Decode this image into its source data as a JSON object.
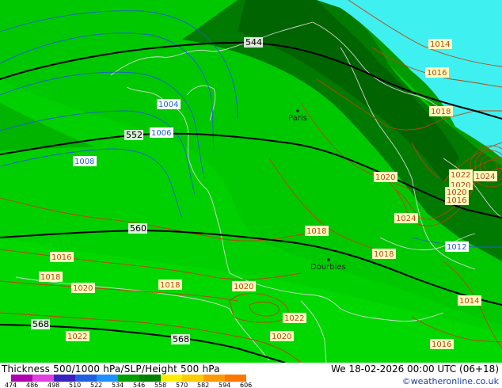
{
  "map": {
    "title": "Thickness 500/1000 hPa/SLP/Height 500 hPa",
    "datetime": "We 18-02-2026 00:00 UTC (06+18)",
    "credit": "©weatheronline.co.uk",
    "cities": [
      "Paris",
      "Dourbies"
    ],
    "thickness_labels": [
      "544",
      "552",
      "560",
      "568",
      "568"
    ],
    "pressure_labels": [
      "1014",
      "1016",
      "1018",
      "1004",
      "1006",
      "1008",
      "1020",
      "1022",
      "1024",
      "1020",
      "1012",
      "1018",
      "1018",
      "1016",
      "1018",
      "1020",
      "1018",
      "1020",
      "1022",
      "1020",
      "1022",
      "1014",
      "1016",
      "1024",
      "1020",
      "1016"
    ],
    "scale_ticks": [
      "474",
      "486",
      "498",
      "510",
      "522",
      "534",
      "546",
      "558",
      "570",
      "582",
      "594",
      "606"
    ],
    "scale_colors": [
      "#b000b0",
      "#e040e0",
      "#3a20c0",
      "#2060e0",
      "#1e90ff",
      "#00a000",
      "#008000",
      "#ffee00",
      "#ffcc00",
      "#ff9900",
      "#ff7700"
    ],
    "colors": {
      "sea": "#3ef0f0",
      "green_dark": "#006400",
      "green_mid": "#009b00",
      "green_light": "#00c800",
      "green_bright": "#00d800",
      "thickness_line": "#000000",
      "isobar_low": "#1e5fd0",
      "isobar_high": "#c04010"
    }
  }
}
